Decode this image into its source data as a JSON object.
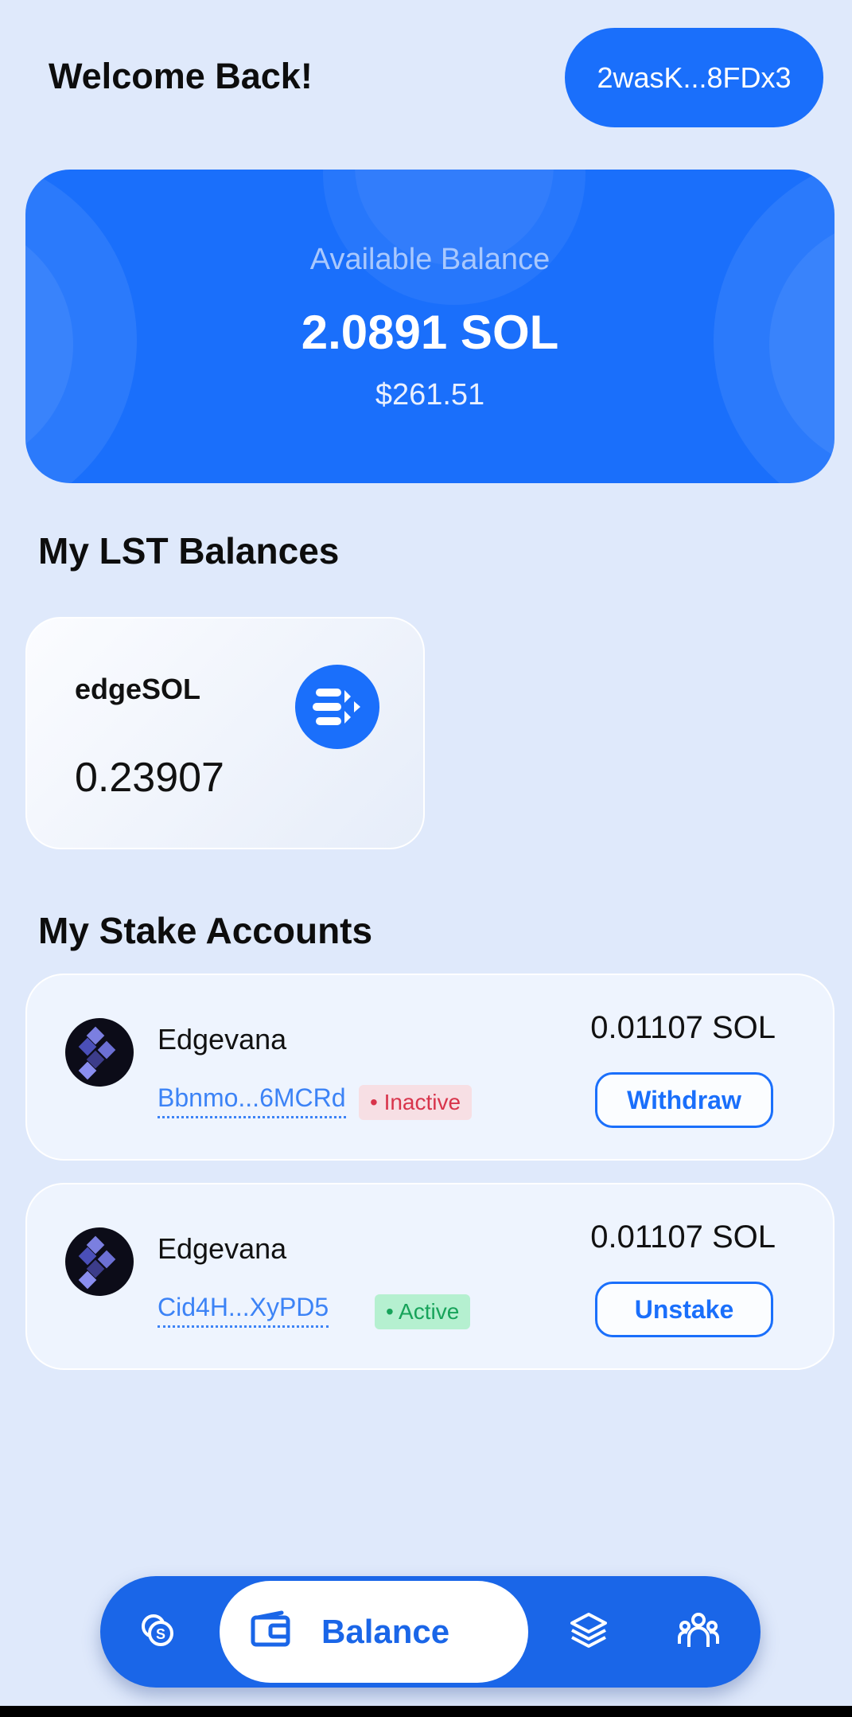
{
  "header": {
    "welcome": "Welcome Back!",
    "wallet_address": "2wasK...8FDx3"
  },
  "balance": {
    "label": "Available Balance",
    "sol": "2.0891 SOL",
    "usd": "$261.51"
  },
  "lst": {
    "title": "My LST Balances",
    "items": [
      {
        "name": "edgeSOL",
        "amount": "0.23907",
        "icon": "edgesol-logo-icon"
      }
    ]
  },
  "stake": {
    "title": "My Stake Accounts",
    "accounts": [
      {
        "validator": "Edgevana",
        "address": "Bbnmo...6MCRd",
        "status": "• Inactive",
        "amount": "0.01107 SOL",
        "action": "Withdraw"
      },
      {
        "validator": "Edgevana",
        "address": "Cid4H...XyPD5",
        "status": "• Active",
        "amount": "0.01107 SOL",
        "action": "Unstake"
      }
    ]
  },
  "nav": {
    "items": [
      {
        "icon": "stake-coin-icon"
      },
      {
        "label": "Balance",
        "icon": "wallet-icon",
        "active": true
      },
      {
        "icon": "layers-icon"
      },
      {
        "icon": "community-icon"
      }
    ]
  },
  "colors": {
    "primary": "#1a6ffb",
    "background": "#dfe9fb",
    "inactive": "#d8344b",
    "active": "#17a35a"
  }
}
